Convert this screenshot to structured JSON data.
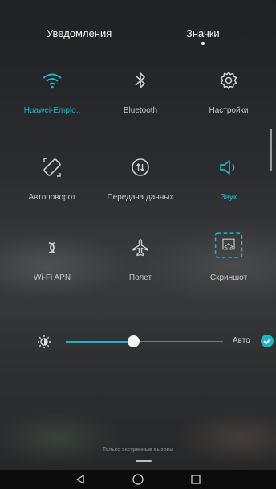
{
  "tabs": {
    "notifications": "Уведомления",
    "icons": "Значки"
  },
  "tiles": [
    {
      "label": "Huawei-Emplo..",
      "icon": "wifi-icon",
      "active": true
    },
    {
      "label": "Bluetooth",
      "icon": "bluetooth-icon",
      "active": false
    },
    {
      "label": "Настройки",
      "icon": "settings-gear-icon",
      "active": false
    },
    {
      "label": "Автоповорот",
      "icon": "auto-rotate-icon",
      "active": false
    },
    {
      "label": "Передача данных",
      "icon": "mobile-data-icon",
      "active": false
    },
    {
      "label": "Звук",
      "icon": "sound-icon",
      "active": true
    },
    {
      "label": "Wi-Fi APN",
      "icon": "wifi-apn-icon",
      "active": false
    },
    {
      "label": "Полет",
      "icon": "airplane-icon",
      "active": false
    },
    {
      "label": "Скриншот",
      "icon": "screenshot-icon",
      "active": false
    }
  ],
  "brightness": {
    "auto_label": "Авто",
    "level": 0.43,
    "auto_enabled": true
  },
  "bottom_text": "Только экстренные вызовы",
  "colors": {
    "accent": "#1fb5c8",
    "text": "#c8c8c8",
    "navbar": "#0b0b0c"
  }
}
